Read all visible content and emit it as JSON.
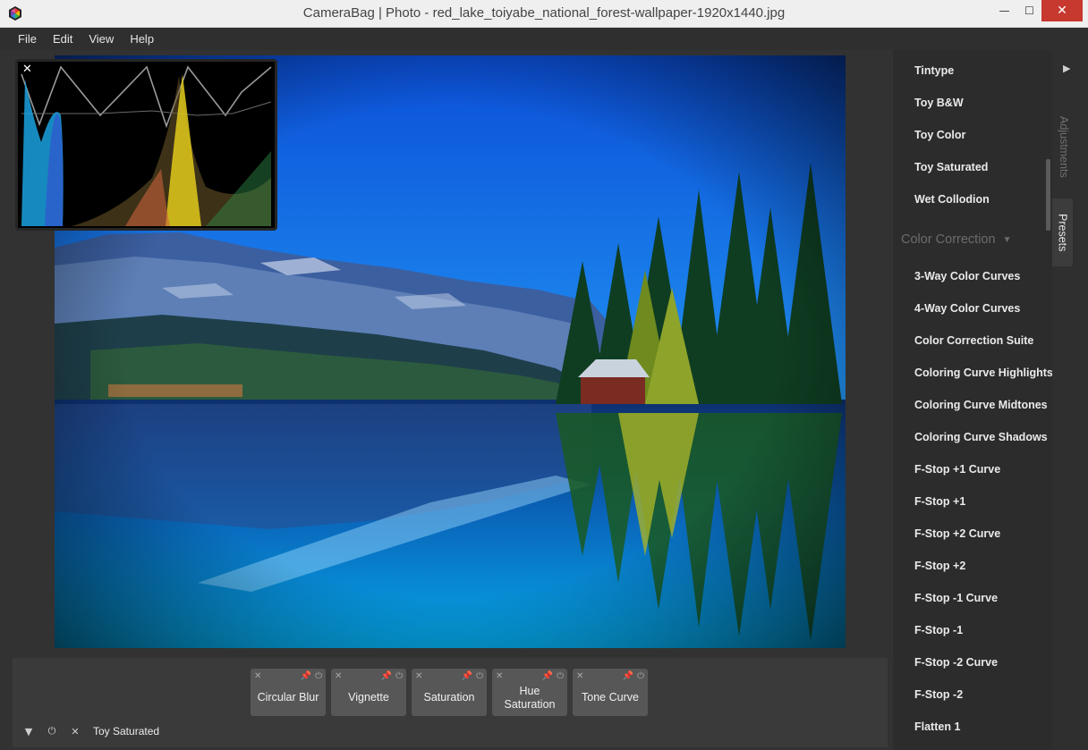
{
  "window": {
    "title": "CameraBag | Photo - red_lake_toiyabe_national_forest-wallpaper-1920x1440.jpg",
    "minimize_glyph": "—",
    "maximize_glyph": "☐",
    "close_glyph": "✕"
  },
  "menu": [
    "File",
    "Edit",
    "View",
    "Help"
  ],
  "histogram": {
    "close_glyph": "✕"
  },
  "stack": {
    "cards": [
      {
        "label": "Circular Blur"
      },
      {
        "label": "Vignette"
      },
      {
        "label": "Saturation"
      },
      {
        "label": "Hue Saturation"
      },
      {
        "label": "Tone Curve"
      }
    ],
    "current_preset": "Toy Saturated"
  },
  "presets": {
    "top_items": [
      "Tintype",
      "Toy B&W",
      "Toy Color",
      "Toy Saturated",
      "Wet Collodion"
    ],
    "section_title": "Color Correction",
    "section_items": [
      "3-Way Color Curves",
      "4-Way Color Curves",
      "Color Correction Suite",
      "Coloring Curve Highlights",
      "Coloring Curve Midtones",
      "Coloring Curve Shadows",
      "F-Stop +1 Curve",
      "F-Stop +1",
      "F-Stop +2 Curve",
      "F-Stop +2",
      "F-Stop -1 Curve",
      "F-Stop -1",
      "F-Stop -2 Curve",
      "F-Stop -2",
      "Flatten 1"
    ]
  },
  "tabs": {
    "adjustments": "Adjustments",
    "presets": "Presets"
  },
  "colors": {
    "accent_close": "#c7382e",
    "panel_bg": "#2c2c2c",
    "card_bg": "#575757"
  }
}
